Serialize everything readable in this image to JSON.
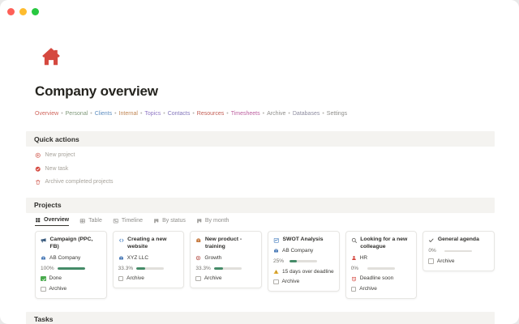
{
  "window": {
    "traffic_lights": {
      "close": "#fe5f57",
      "minimize": "#febc2e",
      "zoom": "#28c840"
    }
  },
  "page": {
    "icon": "home-icon",
    "icon_color": "#d5483f",
    "title": "Company overview"
  },
  "nav": {
    "separator": "•",
    "items": [
      {
        "label": "Overview",
        "color": "#d0655c"
      },
      {
        "label": "Personal",
        "color": "#7f9879"
      },
      {
        "label": "Clients",
        "color": "#5f8fc0"
      },
      {
        "label": "Internal",
        "color": "#c08552"
      },
      {
        "label": "Topics",
        "color": "#9179c6"
      },
      {
        "label": "Contacts",
        "color": "#8476bb"
      },
      {
        "label": "Resources",
        "color": "#c25d54"
      },
      {
        "label": "Timesheets",
        "color": "#bc5f9f"
      },
      {
        "label": "Archive",
        "color": "#8f8e8b"
      },
      {
        "label": "Databases",
        "color": "#8e8da0"
      },
      {
        "label": "Settings",
        "color": "#8f8e8b"
      }
    ]
  },
  "quick_actions": {
    "heading": "Quick actions",
    "items": [
      {
        "icon": "plus-circle-icon",
        "icon_color": "#d5695f",
        "label": "New project"
      },
      {
        "icon": "check-circle-icon",
        "icon_color": "#d5483f",
        "label": "New task"
      },
      {
        "icon": "trash-icon",
        "icon_color": "#d5695f",
        "label": "Archive completed projects"
      }
    ]
  },
  "projects": {
    "heading": "Projects",
    "tabs": [
      {
        "icon": "gallery-icon",
        "label": "Overview",
        "active": true
      },
      {
        "icon": "table-icon",
        "label": "Table"
      },
      {
        "icon": "timeline-icon",
        "label": "Timeline"
      },
      {
        "icon": "board-icon",
        "label": "By status"
      },
      {
        "icon": "board-icon",
        "label": "By month"
      }
    ],
    "cards": [
      {
        "icon": "megaphone-icon",
        "icon_color": "#38597c",
        "title": "Campaign (PPC, FB)",
        "company": {
          "icon": "briefcase-icon",
          "icon_color": "#4d7cb8",
          "label": "AB Company"
        },
        "progress": {
          "label": "100%",
          "value": 100
        },
        "status": {
          "label": "Done",
          "checked": true
        },
        "archive_label": "Archive"
      },
      {
        "icon": "code-icon",
        "icon_color": "#4a81c0",
        "title": "Creating a new website",
        "company": {
          "icon": "briefcase-icon",
          "icon_color": "#4d7cb8",
          "label": "XYZ LLC"
        },
        "progress": {
          "label": "33.3%",
          "value": 33.3
        },
        "archive_label": "Archive"
      },
      {
        "icon": "toolbox-icon",
        "icon_color": "#c4763a",
        "title": "New product - training",
        "company": {
          "icon": "target-icon",
          "icon_color": "#b0443a",
          "label": "Growth"
        },
        "progress": {
          "label": "33.3%",
          "value": 33.3
        },
        "archive_label": "Archive"
      },
      {
        "icon": "chart-icon",
        "icon_color": "#4a81c0",
        "title": "SWOT Analysis",
        "company": {
          "icon": "briefcase-icon",
          "icon_color": "#4d7cb8",
          "label": "AB Company"
        },
        "progress": {
          "label": "25%",
          "value": 25
        },
        "warning": {
          "icon": "warning-icon",
          "icon_color": "#e9b43c",
          "label": "15 days over deadline"
        },
        "archive_label": "Archive"
      },
      {
        "icon": "search-icon",
        "icon_color": "#5f5e5b",
        "title": "Looking for a new colleague",
        "company": {
          "icon": "person-icon",
          "icon_color": "#d5483f",
          "label": "HR"
        },
        "progress": {
          "label": "0%",
          "value": 0
        },
        "deadline": {
          "icon": "alarm-icon",
          "icon_color": "#d5483f",
          "label": "Deadline soon"
        },
        "archive_label": "Archive"
      },
      {
        "icon": "check-icon",
        "icon_color": "#44433f",
        "title": "General agenda",
        "progress": {
          "label": "0%",
          "value": 0
        },
        "archive_label": "Archive"
      }
    ]
  },
  "tasks": {
    "heading": "Tasks"
  }
}
